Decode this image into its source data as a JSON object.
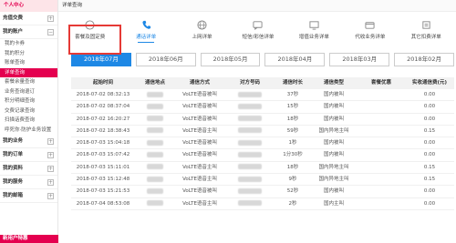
{
  "sidebar": {
    "top_label": "个人中心",
    "groups": [
      {
        "label": "充值交费",
        "toggle": "+"
      },
      {
        "label": "我的账户",
        "toggle": "−"
      }
    ],
    "items": [
      "我的卡券",
      "我的积分",
      "账单查询",
      "详单查询",
      "套餐余量查询",
      "业务查询退订",
      "积分明细查询",
      "交费记录查询",
      "扫描话费查询",
      "呼死你·防护业务设置"
    ],
    "active_index": 3,
    "groups_after": [
      {
        "label": "我的业务",
        "toggle": "+"
      },
      {
        "label": "我的订单",
        "toggle": "+"
      },
      {
        "label": "我的资料",
        "toggle": "+"
      },
      {
        "label": "我的服务",
        "toggle": "+"
      },
      {
        "label": "我的邮箱",
        "toggle": "+"
      }
    ],
    "bottom_label": "新用户特惠"
  },
  "page_title": "详单查询",
  "tabs": [
    {
      "label": "套餐及固定费",
      "icon": "circle-icon"
    },
    {
      "label": "通话详单",
      "icon": "phone-icon"
    },
    {
      "label": "上网详单",
      "icon": "globe-icon"
    },
    {
      "label": "短信/彩信详单",
      "icon": "message-icon"
    },
    {
      "label": "增值业务详单",
      "icon": "tv-icon"
    },
    {
      "label": "代收业务详单",
      "icon": "wallet-icon"
    },
    {
      "label": "其它扣费详单",
      "icon": "fee-icon"
    }
  ],
  "active_tab": 1,
  "months": [
    "2018年07月",
    "2018年06月",
    "2018年05月",
    "2018年04月",
    "2018年03月",
    "2018年02月"
  ],
  "active_month": 0,
  "table": {
    "headers": [
      "起始时间",
      "通信地点",
      "通信方式",
      "对方号码",
      "通信时长",
      "通信类型",
      "套餐优惠",
      "实收通信费(元)"
    ],
    "rows": [
      {
        "time": "2018-07-02 08:32:13",
        "mode": "VoLTE语音被叫",
        "duration": "37秒",
        "type": "国内被叫",
        "fee": "0.00"
      },
      {
        "time": "2018-07-02 08:37:04",
        "mode": "VoLTE语音被叫",
        "duration": "15秒",
        "type": "国内被叫",
        "fee": "0.00"
      },
      {
        "time": "2018-07-02 16:20:27",
        "mode": "VoLTE语音被叫",
        "duration": "18秒",
        "type": "国内被叫",
        "fee": "0.00"
      },
      {
        "time": "2018-07-02 18:38:43",
        "mode": "VoLTE语音主叫",
        "duration": "59秒",
        "type": "国内异地主叫",
        "fee": "0.15"
      },
      {
        "time": "2018-07-03 15:04:18",
        "mode": "VoLTE语音被叫",
        "duration": "1秒",
        "type": "国内被叫",
        "fee": "0.00"
      },
      {
        "time": "2018-07-03 15:07:42",
        "mode": "VoLTE语音被叫",
        "duration": "1分30秒",
        "type": "国内被叫",
        "fee": "0.00"
      },
      {
        "time": "2018-07-03 15:11:01",
        "mode": "VoLTE语音主叫",
        "duration": "18秒",
        "type": "国内异地主叫",
        "fee": "0.15"
      },
      {
        "time": "2018-07-03 15:12:48",
        "mode": "VoLTE语音主叫",
        "duration": "9秒",
        "type": "国内异地主叫",
        "fee": "0.15"
      },
      {
        "time": "2018-07-03 15:21:53",
        "mode": "VoLTE语音被叫",
        "duration": "52秒",
        "type": "国内被叫",
        "fee": "0.00"
      },
      {
        "time": "2018-07-04 08:53:08",
        "mode": "VoLTE语音主叫",
        "duration": "2秒",
        "type": "国内主叫",
        "fee": "0.00"
      }
    ]
  },
  "colors": {
    "brand": "#e4004f",
    "accent": "#1e88e5",
    "highlight": "#e53935"
  }
}
